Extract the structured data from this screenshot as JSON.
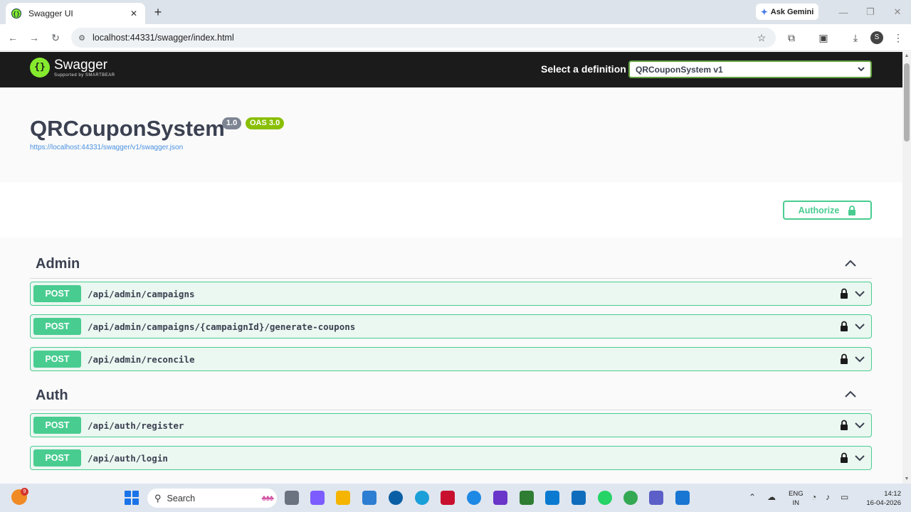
{
  "browser": {
    "tab_title": "Swagger UI",
    "gemini_label": "Ask Gemini",
    "url": "localhost:44331/swagger/index.html",
    "profile_initial": "S"
  },
  "topbar": {
    "logo_name": "Swagger",
    "logo_sub": "Supported by SMARTBEAR",
    "definition_label": "Select a definition",
    "definition_value": "QRCouponSystem v1"
  },
  "info": {
    "title": "QRCouponSystem",
    "version": "1.0",
    "oas": "OAS 3.0",
    "spec_url": "https://localhost:44331/swagger/v1/swagger.json"
  },
  "scheme": {
    "authorize_label": "Authorize"
  },
  "tags": [
    {
      "name": "Admin",
      "operations": [
        {
          "method": "POST",
          "path": "/api/admin/campaigns"
        },
        {
          "method": "POST",
          "path": "/api/admin/campaigns/{campaignId}/generate-coupons"
        },
        {
          "method": "POST",
          "path": "/api/admin/reconcile"
        }
      ]
    },
    {
      "name": "Auth",
      "operations": [
        {
          "method": "POST",
          "path": "/api/auth/register"
        },
        {
          "method": "POST",
          "path": "/api/auth/login"
        }
      ]
    }
  ],
  "taskbar": {
    "search_placeholder": "Search",
    "notification_count": "9",
    "lang_line1": "ENG",
    "lang_line2": "IN",
    "time": "14:12",
    "date": "16-04-2026"
  },
  "colors": {
    "post_green": "#49cc90",
    "post_bg": "#ebf7f1",
    "topbar_bg": "#1b1b1b",
    "select_border": "#62a03f",
    "version_badge": "#7d8492",
    "oas_badge": "#89bf04"
  }
}
